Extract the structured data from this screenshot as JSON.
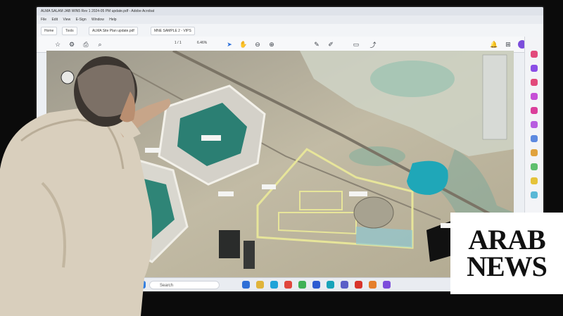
{
  "screen": {
    "window_title": "ALMA SALAM JAB WIN5 Rev 1 2024-05 PM update.pdf - Adobe Acrobat",
    "menu": [
      "File",
      "Edit",
      "View",
      "E-Sign",
      "Window",
      "Help"
    ],
    "tabs": [
      "Home",
      "Tools",
      "ALMA Site Plan update.pdf",
      "MNE SAMPLE 2 - VIPS"
    ],
    "zoom": "6.46%",
    "page": "1 / 1",
    "taskbar_search_placeholder": "Search"
  },
  "logo": {
    "line1": "ARAB",
    "line2": "NEWS"
  },
  "icons": {
    "toolbar": [
      "star-icon",
      "settings-icon",
      "print-icon",
      "search-icon",
      "cursor-icon",
      "hand-icon",
      "zoom-out-icon",
      "zoom-in-icon",
      "comment-icon",
      "pen-icon",
      "highlight-icon",
      "share-icon"
    ],
    "taskbar": [
      "windows-start-icon",
      "search-icon",
      "chrome-icon",
      "folder-icon",
      "edge-icon",
      "mail-icon",
      "teams-icon",
      "acrobat-icon",
      "photos-icon",
      "settings-icon"
    ]
  },
  "colors": {
    "screen_bg": "#eceff3",
    "map_dirt": "#b9b39f",
    "tailings_water": "#2c8f86",
    "pond_blue": "#1fa7b8",
    "plot_outline": "#e7e59a",
    "logo_bg": "#ffffff",
    "logo_text": "#111111"
  }
}
